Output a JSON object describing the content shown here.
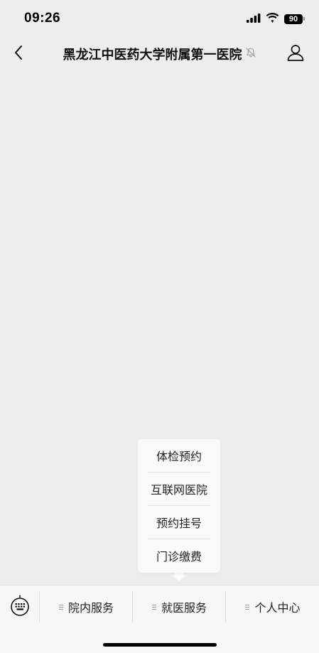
{
  "status_bar": {
    "time": "09:26",
    "battery_level": "90",
    "signal_icon": "cellular-signal-icon",
    "wifi_icon": "wifi-icon"
  },
  "nav": {
    "title": "黑龙江中医药大学附属第一医院",
    "back_icon": "chevron-left-icon",
    "mute_icon": "bell-muted-icon",
    "profile_icon": "person-icon"
  },
  "submenu": {
    "items": [
      {
        "label": "体检预约"
      },
      {
        "label": "互联网医院"
      },
      {
        "label": "预约挂号"
      },
      {
        "label": "门诊缴费"
      }
    ]
  },
  "menu_bar": {
    "keyboard_icon": "keyboard-icon",
    "items": [
      {
        "label": "院内服务"
      },
      {
        "label": "就医服务"
      },
      {
        "label": "个人中心"
      }
    ]
  },
  "colors": {
    "background": "#ededed",
    "menu_bar": "#f7f7f7",
    "popup": "#fafafa",
    "text": "#111111"
  }
}
